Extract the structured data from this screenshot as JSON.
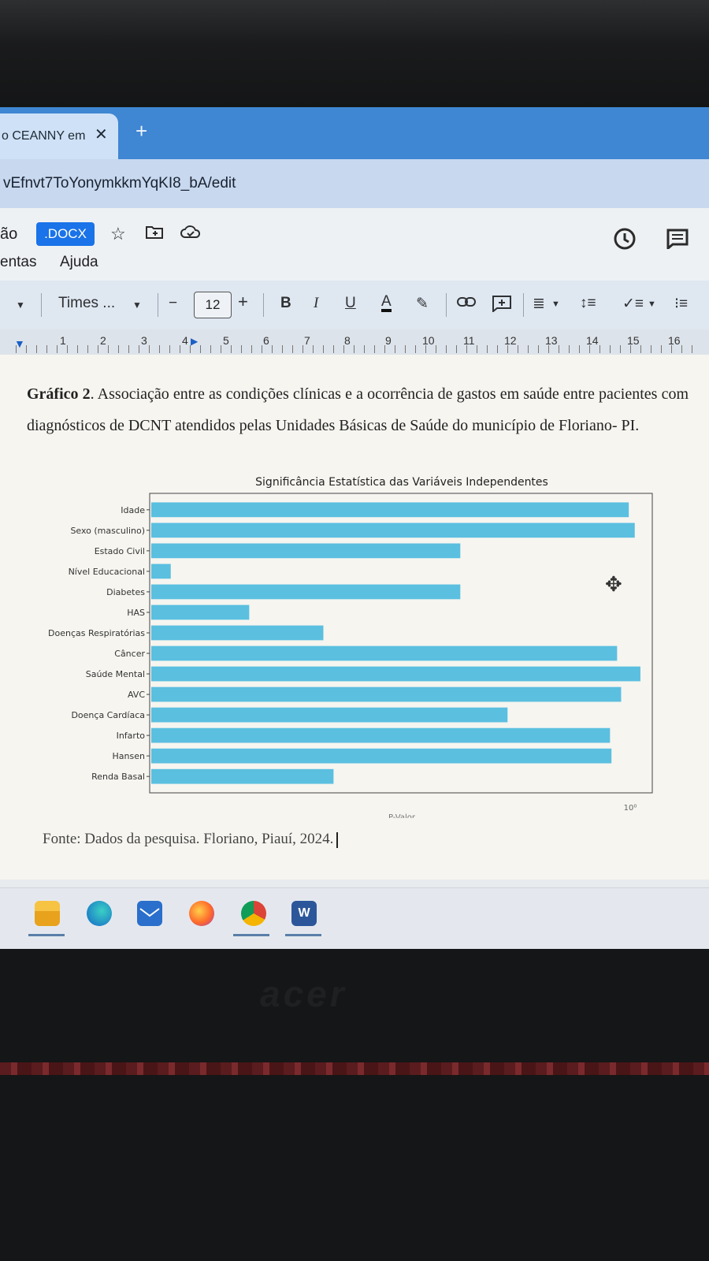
{
  "browser": {
    "tab_title": "o CEANNY em",
    "tab_close": "✕",
    "new_tab": "+",
    "address": "vEfnvt7ToYonymkkmYqKI8_bA/edit"
  },
  "docs_header": {
    "title_fragment": "ão",
    "badge": ".DOCX",
    "menu": [
      "entas",
      "Ajuda"
    ]
  },
  "toolbar": {
    "font": "Times ...",
    "font_size": "12",
    "minus": "−",
    "plus": "+",
    "bold": "B",
    "italic": "I",
    "underline": "U",
    "text_color": "A"
  },
  "ruler": {
    "numbers": [
      "1",
      "2",
      "3",
      "4",
      "5",
      "6",
      "7",
      "8",
      "9",
      "10",
      "11",
      "12",
      "13",
      "14",
      "15",
      "16"
    ]
  },
  "document": {
    "caption_bold": "Gráfico 2",
    "caption_text": ". Associação entre as condições clínicas e a ocorrência de gastos em saúde entre pacientes com diagnósticos de DCNT atendidos pelas Unidades Básicas de Saúde do município de Floriano- PI.",
    "source": "Fonte: Dados da pesquisa. Floriano, Piauí, 2024."
  },
  "chart_data": {
    "type": "bar",
    "orientation": "horizontal",
    "title": "Significância Estatística das Variáveis Independentes",
    "xlabel": "P-Valor",
    "ylabel": "",
    "x_scale": "log",
    "x_tick_label": "10⁰",
    "color": "#5bbfe0",
    "categories": [
      "Idade",
      "Sexo (masculino)",
      "Estado Civil",
      "Nível Educacional",
      "Diabetes",
      "HAS",
      "Doenças Respiratórias",
      "Câncer",
      "Saúde Mental",
      "AVC",
      "Doença Cardíaca",
      "Infarto",
      "Hansen",
      "Renda Basal"
    ],
    "values": [
      0.87,
      0.92,
      0.18,
      0.012,
      0.18,
      0.025,
      0.05,
      0.78,
      0.97,
      0.81,
      0.28,
      0.73,
      0.74,
      0.055
    ],
    "xlim": [
      0.01,
      1.1
    ]
  },
  "taskbar": {
    "apps": [
      "file-explorer-icon",
      "edge-icon",
      "mail-icon",
      "firefox-icon",
      "chrome-icon",
      "word-icon"
    ]
  },
  "bezel": {
    "brand": "acer"
  }
}
